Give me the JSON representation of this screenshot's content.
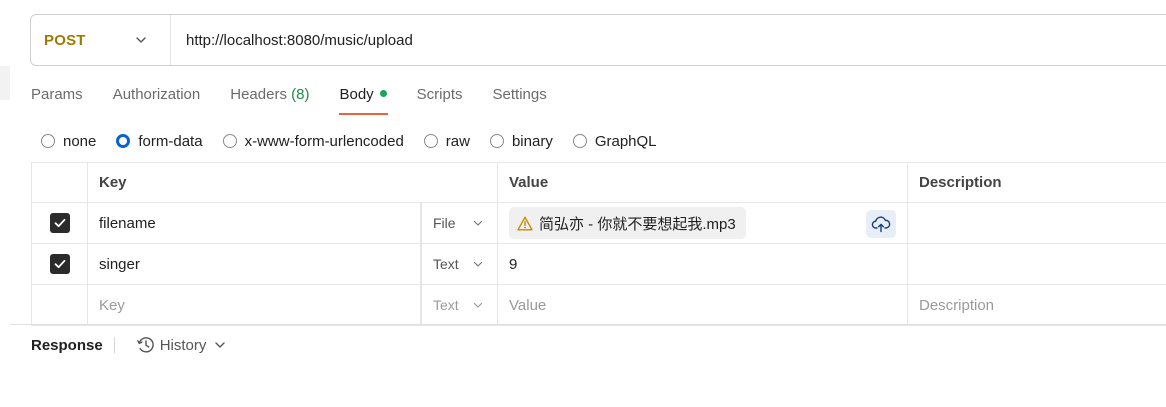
{
  "request": {
    "method": "POST",
    "url": "http://localhost:8080/music/upload"
  },
  "tabs": [
    {
      "label": "Params"
    },
    {
      "label": "Authorization"
    },
    {
      "label": "Headers",
      "count": "(8)"
    },
    {
      "label": "Body"
    },
    {
      "label": "Scripts"
    },
    {
      "label": "Settings"
    }
  ],
  "active_tab": "Body",
  "body_types": [
    {
      "label": "none",
      "selected": false
    },
    {
      "label": "form-data",
      "selected": true
    },
    {
      "label": "x-www-form-urlencoded",
      "selected": false
    },
    {
      "label": "raw",
      "selected": false
    },
    {
      "label": "binary",
      "selected": false
    },
    {
      "label": "GraphQL",
      "selected": false
    }
  ],
  "table": {
    "headers": {
      "key": "Key",
      "value": "Value",
      "description": "Description"
    },
    "rows": [
      {
        "checked": true,
        "key": "filename",
        "type": "File",
        "value": "简弘亦 - 你就不要想起我.mp3",
        "description": ""
      },
      {
        "checked": true,
        "key": "singer",
        "type": "Text",
        "value": "9",
        "description": ""
      }
    ],
    "placeholder": {
      "key": "Key",
      "type": "Text",
      "value": "Value",
      "description": "Description"
    }
  },
  "response": {
    "label": "Response",
    "history_label": "History"
  },
  "colors": {
    "method": "#a07a00",
    "active_tab_underline": "#e8643a",
    "body_dot": "#1ba35a",
    "headers_count": "#1e8a4c",
    "radio_selected": "#0b63d1",
    "warning": "#c98a00"
  }
}
